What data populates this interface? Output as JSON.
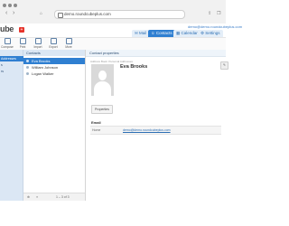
{
  "browser": {
    "url": "demo.roundcubeplus.com"
  },
  "header": {
    "logo": "ube",
    "user": "demo@demo.roundcubeplus.com",
    "tabs": [
      {
        "label": "Mail",
        "selected": false
      },
      {
        "label": "Contacts",
        "selected": true
      },
      {
        "label": "Calendar",
        "selected": false
      },
      {
        "label": "Settings",
        "selected": false
      }
    ]
  },
  "toolbar": {
    "buttons": [
      {
        "label": "Compose",
        "icon": "compose-icon"
      },
      {
        "label": "Print",
        "icon": "print-icon"
      },
      {
        "label": "Import",
        "icon": "import-icon"
      },
      {
        "label": "Export",
        "icon": "export-icon"
      },
      {
        "label": "More",
        "icon": "more-icon"
      }
    ]
  },
  "addressbooks": [
    {
      "label": "Addresses",
      "selected": true
    },
    {
      "label": "s",
      "selected": false
    },
    {
      "label": "rs",
      "selected": false
    }
  ],
  "contacts": {
    "header": "Contacts",
    "items": [
      {
        "name": "Eva Brooks",
        "selected": true
      },
      {
        "name": "William Johnson",
        "selected": false
      },
      {
        "name": "Logan Walker",
        "selected": false
      }
    ],
    "pager": "1 – 3 of 3"
  },
  "properties": {
    "header": "Contact properties",
    "addressbook": "Address Book: Personal Addresses",
    "name": "Eva Brooks",
    "properties_button": "Properties",
    "email_section": "Email",
    "email_label": "Home",
    "email_value": "demo@demo.roundcubeplus.com"
  }
}
